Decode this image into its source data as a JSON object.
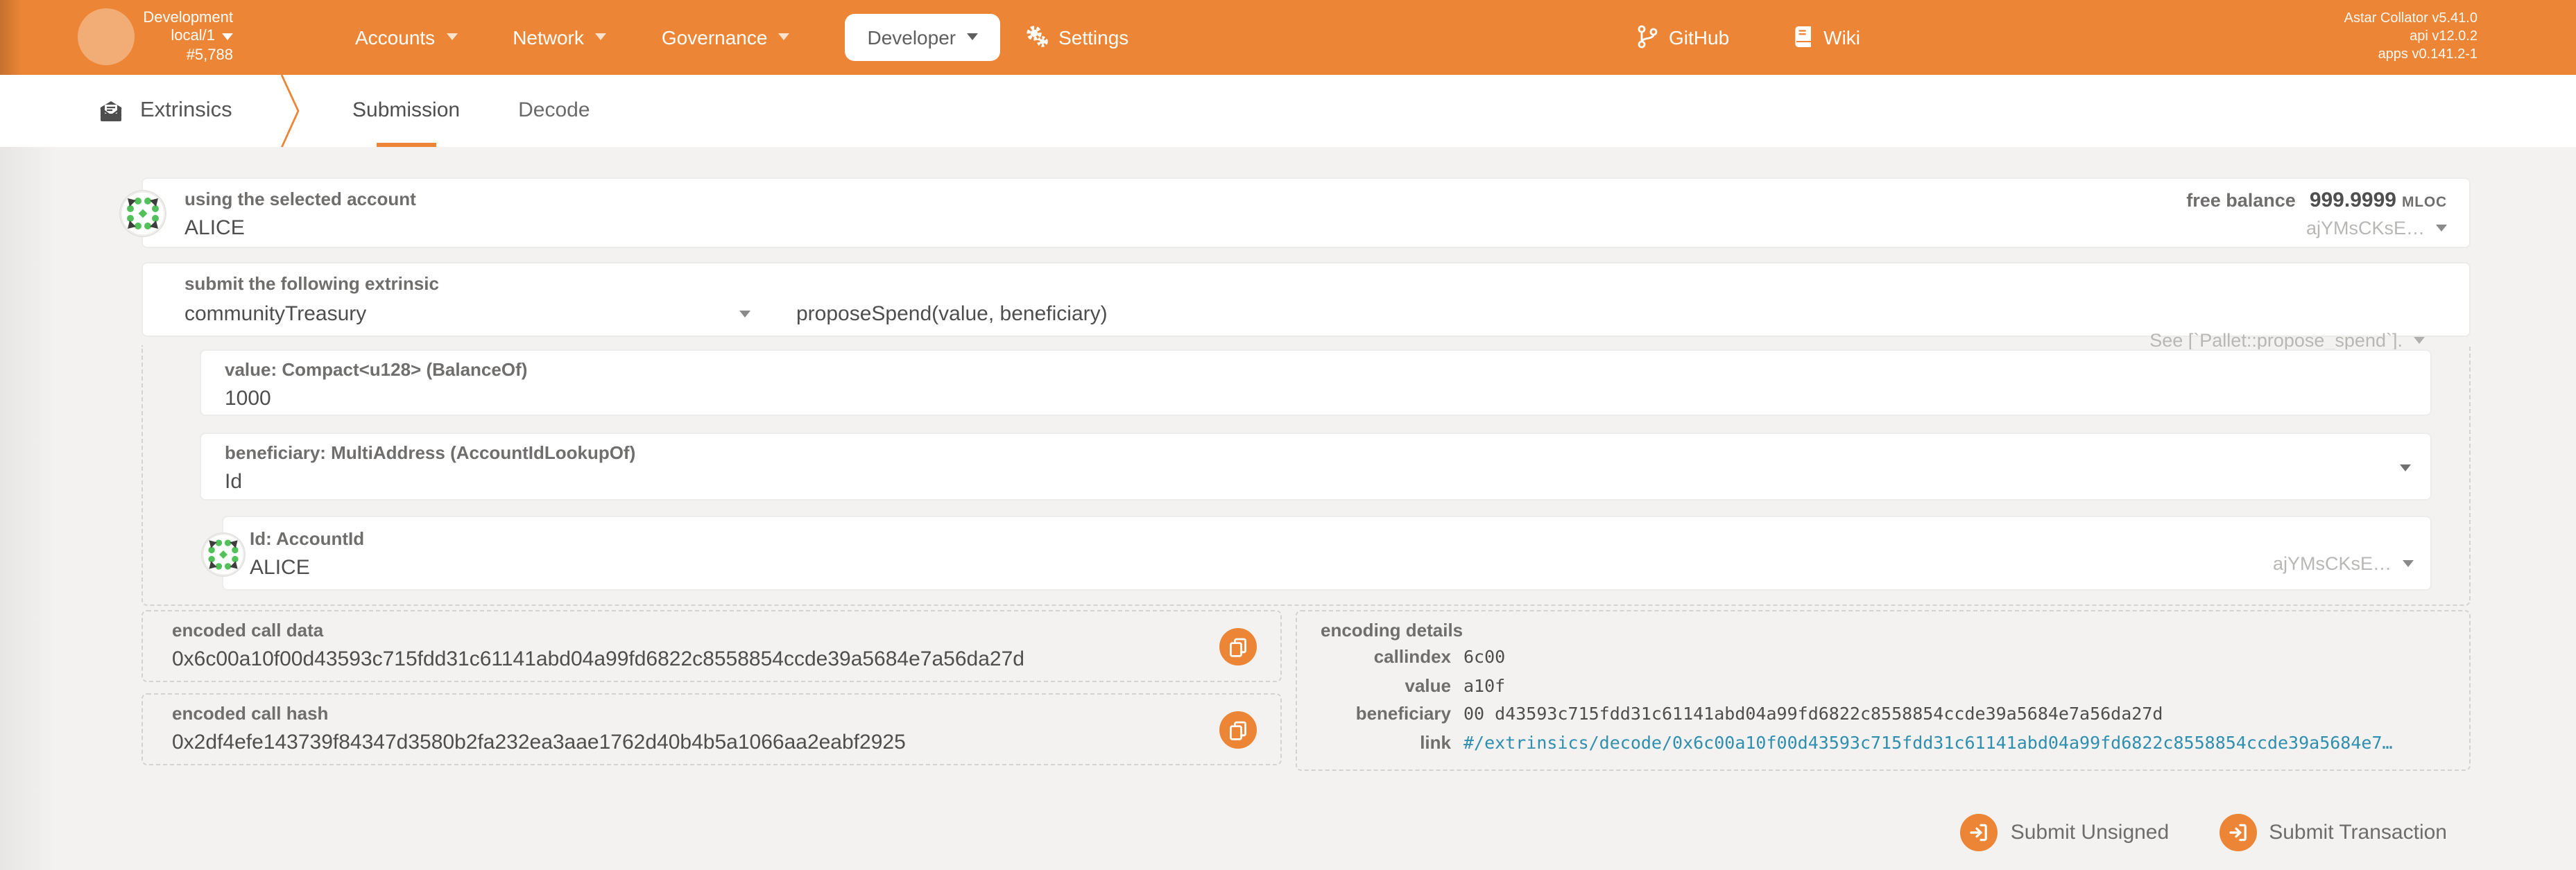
{
  "header": {
    "chain": {
      "name": "Development",
      "node": "local/1",
      "block": "#5,788"
    },
    "nav": [
      {
        "label": "Accounts"
      },
      {
        "label": "Network"
      },
      {
        "label": "Governance"
      },
      {
        "label": "Developer"
      },
      {
        "label": "Settings"
      }
    ],
    "links": [
      {
        "label": "GitHub",
        "icon": "git-branch-icon"
      },
      {
        "label": "Wiki",
        "icon": "book-icon"
      }
    ],
    "versions": [
      "Astar Collator v5.41.0",
      "api v12.0.2",
      "apps v0.141.2-1"
    ]
  },
  "tabbar": {
    "title": "Extrinsics",
    "icon": "envelope-icon",
    "tabs": [
      {
        "label": "Submission",
        "active": true
      },
      {
        "label": "Decode",
        "active": false
      }
    ]
  },
  "account_section": {
    "label": "using the selected account",
    "value": "ALICE",
    "balance_label": "free balance",
    "balance_value": "999.9999",
    "balance_unit": "MLOC",
    "address_short": "ajYMsCKsE…"
  },
  "extrinsic_section": {
    "label": "submit the following extrinsic",
    "pallet": "communityTreasury",
    "method": "proposeSpend(value, beneficiary)",
    "doc": "See [`Pallet::propose_spend`]."
  },
  "params": {
    "value": {
      "label": "value: Compact<u128> (BalanceOf)",
      "value": "1000"
    },
    "beneficiary": {
      "label": "beneficiary: MultiAddress (AccountIdLookupOf)",
      "value": "Id"
    },
    "id": {
      "label": "Id: AccountId",
      "value": "ALICE",
      "address_short": "ajYMsCKsE…"
    }
  },
  "outputs": {
    "call_data": {
      "label": "encoded call data",
      "value": "0x6c00a10f00d43593c715fdd31c61141abd04a99fd6822c8558854ccde39a5684e7a56da27d"
    },
    "call_hash": {
      "label": "encoded call hash",
      "value": "0x2df4efe143739f84347d3580b2fa232ea3aae1762d40b4b5a1066aa2eabf2925"
    }
  },
  "encoding_details": {
    "title": "encoding details",
    "rows": [
      {
        "label": "callindex",
        "value": "6c00"
      },
      {
        "label": "value",
        "value": "a10f"
      },
      {
        "label": "beneficiary",
        "value": "00 d43593c715fdd31c61141abd04a99fd6822c8558854ccde39a5684e7a56da27d"
      },
      {
        "label": "link",
        "value": "#/extrinsics/decode/0x6c00a10f00d43593c715fdd31c61141abd04a99fd6822c8558854ccde39a5684e7…"
      }
    ]
  },
  "actions": [
    {
      "label": "Submit Unsigned",
      "icon": "sign-in-icon"
    },
    {
      "label": "Submit Transaction",
      "icon": "sign-in-icon"
    }
  ],
  "colors": {
    "accent": "#ec8636",
    "link": "#2e8fb0",
    "page_bg": "#f4f2f0",
    "identicon_green": "#52c15a"
  }
}
